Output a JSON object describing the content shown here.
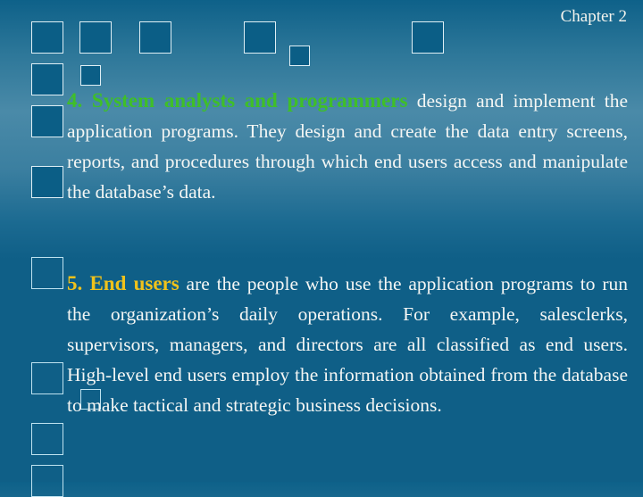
{
  "header": {
    "chapter": "Chapter 2"
  },
  "colors": {
    "background": "#0f5f87",
    "highlight_green": "#3fbf28",
    "highlight_yellow": "#f0c21b",
    "text": "#f4f6f4"
  },
  "items": [
    {
      "number_term": "4. System analysts and programmers",
      "body": " design and implement the application programs. They design and create the data entry screens, reports, and procedures through which end users access and manipulate the database’s data."
    },
    {
      "number_term": "5. End users",
      "body": " are the people who use the application programs to run the organization’s daily operations. For example, salesclerks, supervisors, managers, and directors are all classified as end users. High-level end users employ the information obtained from the database to make tactical and strategic business decisions."
    }
  ]
}
